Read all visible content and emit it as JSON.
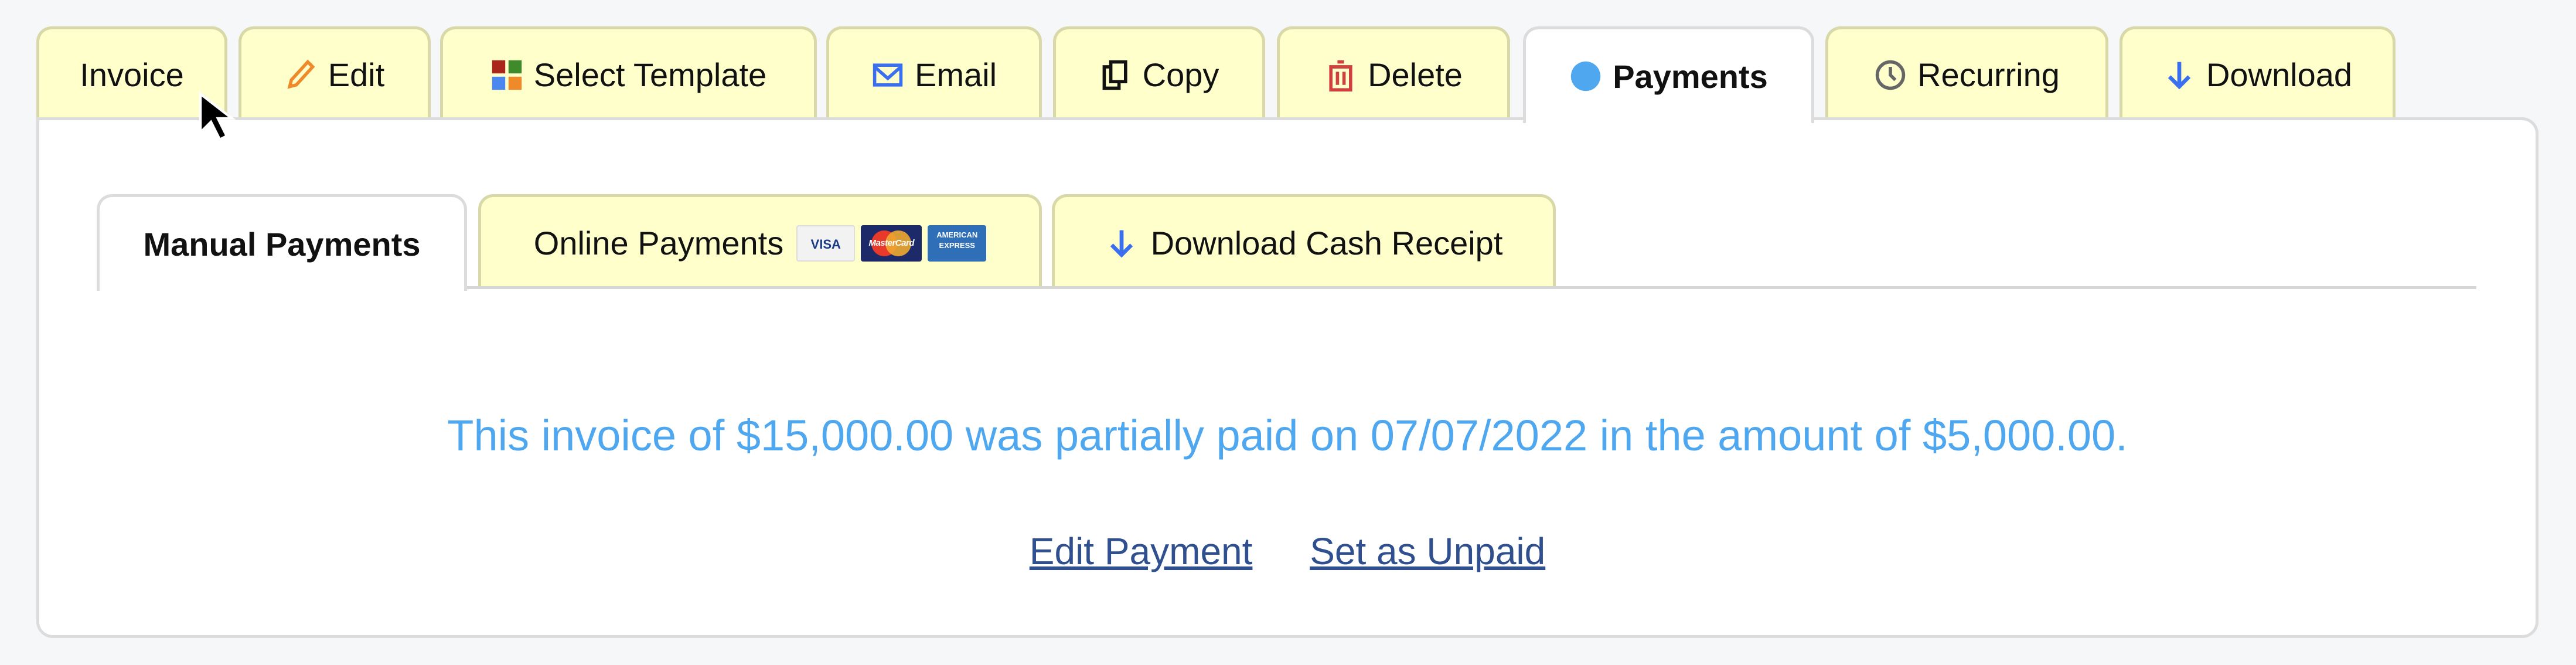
{
  "main_tabs": [
    {
      "label": "Invoice",
      "icon": null
    },
    {
      "label": "Edit",
      "icon": "pencil-icon"
    },
    {
      "label": "Select Template",
      "icon": "template-grid-icon"
    },
    {
      "label": "Email",
      "icon": "envelope-icon"
    },
    {
      "label": "Copy",
      "icon": "copy-icon"
    },
    {
      "label": "Delete",
      "icon": "trash-icon"
    },
    {
      "label": "Payments",
      "icon": "circle-icon",
      "active": true
    },
    {
      "label": "Recurring",
      "icon": "clock-icon"
    },
    {
      "label": "Download",
      "icon": "arrow-down-icon"
    }
  ],
  "sub_tabs": [
    {
      "label": "Manual Payments",
      "active": true
    },
    {
      "label": "Online Payments",
      "cards": [
        "VISA",
        "MasterCard",
        "AMERICAN EXPRESS"
      ]
    },
    {
      "label": "Download Cash Receipt",
      "icon": "arrow-down-icon"
    }
  ],
  "message": "This invoice of $15,000.00 was partially paid on 07/07/2022 in the amount of $5,000.00.",
  "links": {
    "edit_payment": "Edit Payment",
    "set_unpaid": "Set as Unpaid"
  },
  "colors": {
    "tab_bg": "#ffffcc",
    "message": "#4fa8ef",
    "link": "#2f4f8f",
    "payments_dot": "#4fa8ef",
    "delete_red": "#d04040",
    "edit_orange": "#ef8a2a",
    "download_blue": "#3a6ff0"
  }
}
